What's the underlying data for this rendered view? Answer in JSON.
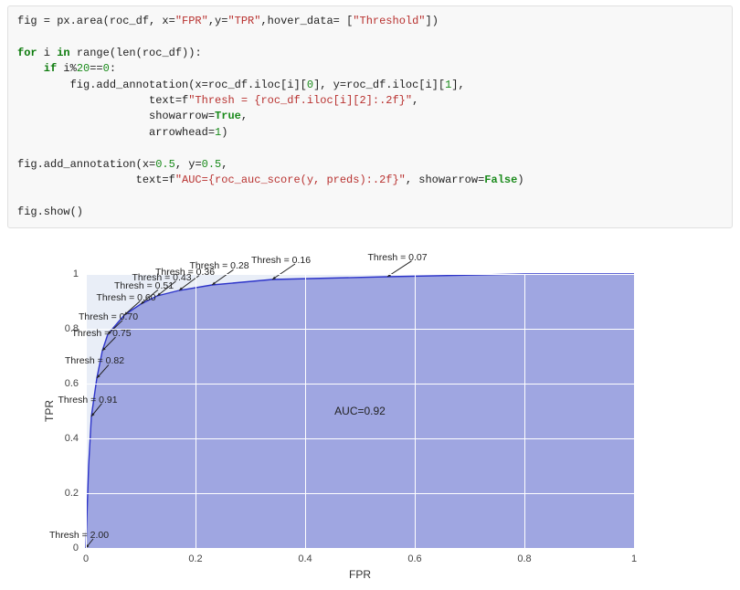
{
  "code": {
    "line1_a": "fig = px.area(roc_df, x=",
    "line1_s1": "\"FPR\"",
    "line1_b": ",y=",
    "line1_s2": "\"TPR\"",
    "line1_c": ",hover_data= [",
    "line1_s3": "\"Threshold\"",
    "line1_d": "])",
    "line2a": "for",
    "line2b": " i ",
    "line2c": "in",
    "line2d": " range(len(roc_df)):",
    "line3a": "    if",
    "line3b": " i%",
    "line3n1": "20",
    "line3c": "==",
    "line3n2": "0",
    "line3d": ":",
    "line4a": "        fig.add_annotation(x=roc_df.iloc[i][",
    "line4n1": "0",
    "line4b": "], y=roc_df.iloc[i][",
    "line4n2": "1",
    "line4c": "],",
    "line5a": "                    text=f",
    "line5s": "\"Thresh = {roc_df.iloc[i][2]:.2f}\"",
    "line5b": ",",
    "line6a": "                    showarrow=",
    "line6k": "True",
    "line6b": ",",
    "line7a": "                    arrowhead=",
    "line7n": "1",
    "line7b": ")",
    "line8a": "fig.add_annotation(x=",
    "line8n1": "0.5",
    "line8b": ", y=",
    "line8n2": "0.5",
    "line8c": ",",
    "line9a": "                  text=f",
    "line9s": "\"AUC={roc_auc_score(y, preds):.2f}\"",
    "line9b": ", showarrow=",
    "line9k": "False",
    "line9c": ")",
    "line10": "fig.show()"
  },
  "chart_data": {
    "type": "area",
    "xlabel": "FPR",
    "ylabel": "TPR",
    "xlim": [
      0,
      1
    ],
    "ylim": [
      0,
      1
    ],
    "xticks": [
      0,
      0.2,
      0.4,
      0.6,
      0.8,
      1
    ],
    "yticks": [
      0,
      0.2,
      0.4,
      0.6,
      0.8,
      1
    ],
    "auc_annotation": {
      "text": "AUC=0.92",
      "x": 0.5,
      "y": 0.5
    },
    "threshold_annotations": [
      {
        "text": "Thresh = 2.00",
        "fpr": 0.0,
        "tpr": 0.0
      },
      {
        "text": "Thresh = 0.91",
        "fpr": 0.01,
        "tpr": 0.48
      },
      {
        "text": "Thresh = 0.82",
        "fpr": 0.02,
        "tpr": 0.62
      },
      {
        "text": "Thresh = 0.75",
        "fpr": 0.03,
        "tpr": 0.72
      },
      {
        "text": "Thresh = 0.70",
        "fpr": 0.04,
        "tpr": 0.78
      },
      {
        "text": "Thresh = 0.60",
        "fpr": 0.07,
        "tpr": 0.85
      },
      {
        "text": "Thresh = 0.51",
        "fpr": 0.1,
        "tpr": 0.89
      },
      {
        "text": "Thresh = 0.43",
        "fpr": 0.13,
        "tpr": 0.92
      },
      {
        "text": "Thresh = 0.36",
        "fpr": 0.17,
        "tpr": 0.94
      },
      {
        "text": "Thresh = 0.28",
        "fpr": 0.23,
        "tpr": 0.96
      },
      {
        "text": "Thresh = 0.16",
        "fpr": 0.34,
        "tpr": 0.98
      },
      {
        "text": "Thresh = 0.07",
        "fpr": 0.55,
        "tpr": 0.99
      }
    ],
    "roc_curve": [
      {
        "fpr": 0.0,
        "tpr": 0.0
      },
      {
        "fpr": 0.005,
        "tpr": 0.3
      },
      {
        "fpr": 0.01,
        "tpr": 0.48
      },
      {
        "fpr": 0.02,
        "tpr": 0.62
      },
      {
        "fpr": 0.03,
        "tpr": 0.72
      },
      {
        "fpr": 0.04,
        "tpr": 0.78
      },
      {
        "fpr": 0.07,
        "tpr": 0.85
      },
      {
        "fpr": 0.1,
        "tpr": 0.89
      },
      {
        "fpr": 0.13,
        "tpr": 0.92
      },
      {
        "fpr": 0.17,
        "tpr": 0.94
      },
      {
        "fpr": 0.23,
        "tpr": 0.96
      },
      {
        "fpr": 0.34,
        "tpr": 0.98
      },
      {
        "fpr": 0.55,
        "tpr": 0.99
      },
      {
        "fpr": 0.8,
        "tpr": 1.0
      },
      {
        "fpr": 1.0,
        "tpr": 1.0
      }
    ]
  }
}
